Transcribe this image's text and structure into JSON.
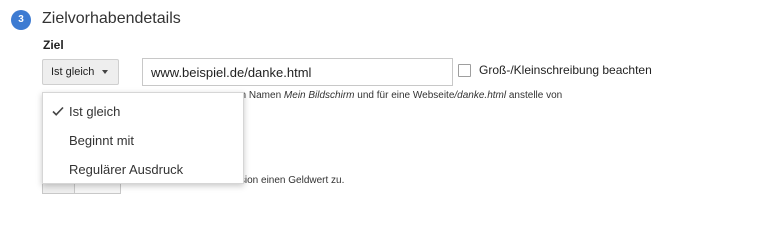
{
  "section": {
    "step_number": "3",
    "title": "Zielvorhabendetails"
  },
  "goal": {
    "label": "Ziel",
    "match_type": "Ist gleich",
    "url_value": "www.beispiel.de/danke.html",
    "case_sensitive_label": "Groß-/Kleinschreibung beachten",
    "case_sensitive_checked": false
  },
  "helper": {
    "part1": "en Namen ",
    "italic1": "Mein Bildschirm",
    "part2": " und für eine Webseite",
    "italic2": "/danke.html",
    "part3": " anstelle von"
  },
  "value_text": "ersion einen Geldwert zu.",
  "dropdown": {
    "items": [
      {
        "label": "Ist gleich",
        "selected": true
      },
      {
        "label": "Beginnt mit",
        "selected": false
      },
      {
        "label": "Regulärer Ausdruck",
        "selected": false
      }
    ]
  },
  "colors": {
    "accent": "#3d7bd2"
  }
}
